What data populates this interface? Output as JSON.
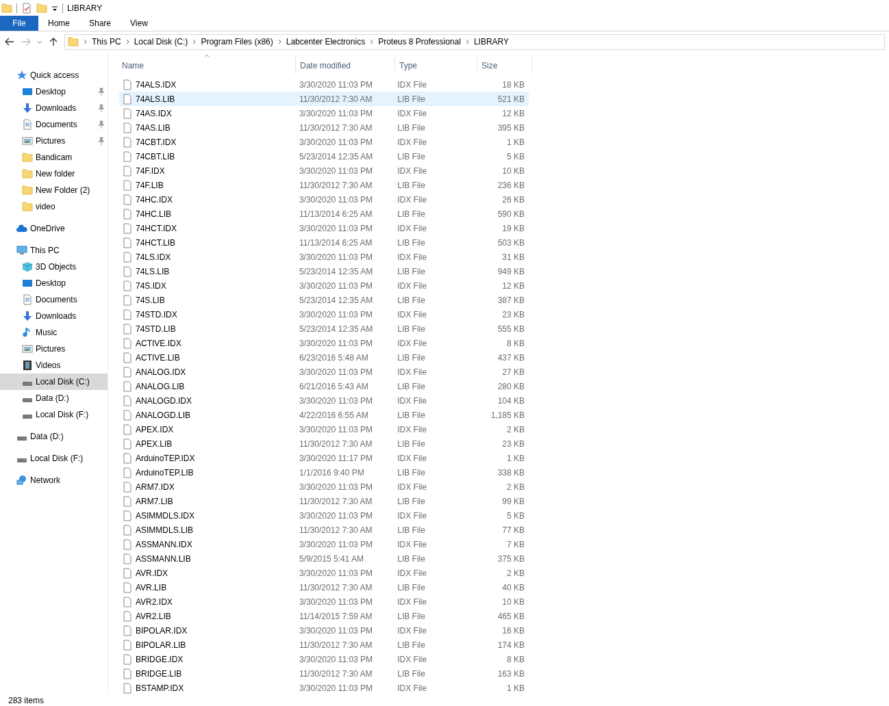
{
  "window": {
    "title": "LIBRARY"
  },
  "ribbon_tabs": [
    {
      "label": "File",
      "selected": true
    },
    {
      "label": "Home",
      "selected": false
    },
    {
      "label": "Share",
      "selected": false
    },
    {
      "label": "View",
      "selected": false
    }
  ],
  "breadcrumb": [
    "This PC",
    "Local Disk (C:)",
    "Program Files (x86)",
    "Labcenter Electronics",
    "Proteus 8 Professional",
    "LIBRARY"
  ],
  "sidebar": [
    {
      "label": "Quick access",
      "kind": "star",
      "selected": false,
      "children": [
        {
          "label": "Desktop",
          "kind": "desktop",
          "pinned": true,
          "selected": false
        },
        {
          "label": "Downloads",
          "kind": "downloads",
          "pinned": true,
          "selected": false
        },
        {
          "label": "Documents",
          "kind": "documents",
          "pinned": true,
          "selected": false
        },
        {
          "label": "Pictures",
          "kind": "pictures",
          "pinned": true,
          "selected": false
        },
        {
          "label": "Bandicam",
          "kind": "folder",
          "pinned": false,
          "selected": false
        },
        {
          "label": "New folder",
          "kind": "folder",
          "pinned": false,
          "selected": false
        },
        {
          "label": "New Folder (2)",
          "kind": "folder",
          "pinned": false,
          "selected": false
        },
        {
          "label": "video",
          "kind": "folder",
          "pinned": false,
          "selected": false
        }
      ]
    },
    {
      "label": "OneDrive",
      "kind": "cloud",
      "selected": false
    },
    {
      "label": "This PC",
      "kind": "pc",
      "selected": false,
      "children": [
        {
          "label": "3D Objects",
          "kind": "cube",
          "pinned": false,
          "selected": false
        },
        {
          "label": "Desktop",
          "kind": "desktop",
          "pinned": false,
          "selected": false
        },
        {
          "label": "Documents",
          "kind": "documents",
          "pinned": false,
          "selected": false
        },
        {
          "label": "Downloads",
          "kind": "downloads",
          "pinned": false,
          "selected": false
        },
        {
          "label": "Music",
          "kind": "music",
          "pinned": false,
          "selected": false
        },
        {
          "label": "Pictures",
          "kind": "pictures",
          "pinned": false,
          "selected": false
        },
        {
          "label": "Videos",
          "kind": "videos",
          "pinned": false,
          "selected": false
        },
        {
          "label": "Local Disk (C:)",
          "kind": "drive",
          "pinned": false,
          "selected": true
        },
        {
          "label": "Data (D:)",
          "kind": "drive",
          "pinned": false,
          "selected": false
        },
        {
          "label": "Local Disk (F:)",
          "kind": "drive",
          "pinned": false,
          "selected": false
        }
      ]
    },
    {
      "label": "Data (D:)",
      "kind": "drive",
      "selected": false
    },
    {
      "label": "Local Disk (F:)",
      "kind": "drive",
      "selected": false
    },
    {
      "label": "Network",
      "kind": "network",
      "selected": false
    }
  ],
  "table": {
    "columns": [
      "Name",
      "Date modified",
      "Type",
      "Size"
    ],
    "rows": [
      {
        "name": "74ALS.IDX",
        "date": "3/30/2020 11:03 PM",
        "type": "IDX File",
        "size": "18 KB",
        "highlighted": false
      },
      {
        "name": "74ALS.LIB",
        "date": "11/30/2012 7:30 AM",
        "type": "LIB File",
        "size": "521 KB",
        "highlighted": true
      },
      {
        "name": "74AS.IDX",
        "date": "3/30/2020 11:03 PM",
        "type": "IDX File",
        "size": "12 KB",
        "highlighted": false
      },
      {
        "name": "74AS.LIB",
        "date": "11/30/2012 7:30 AM",
        "type": "LIB File",
        "size": "395 KB",
        "highlighted": false
      },
      {
        "name": "74CBT.IDX",
        "date": "3/30/2020 11:03 PM",
        "type": "IDX File",
        "size": "1 KB",
        "highlighted": false
      },
      {
        "name": "74CBT.LIB",
        "date": "5/23/2014 12:35 AM",
        "type": "LIB File",
        "size": "5 KB",
        "highlighted": false
      },
      {
        "name": "74F.IDX",
        "date": "3/30/2020 11:03 PM",
        "type": "IDX File",
        "size": "10 KB",
        "highlighted": false
      },
      {
        "name": "74F.LIB",
        "date": "11/30/2012 7:30 AM",
        "type": "LIB File",
        "size": "236 KB",
        "highlighted": false
      },
      {
        "name": "74HC.IDX",
        "date": "3/30/2020 11:03 PM",
        "type": "IDX File",
        "size": "26 KB",
        "highlighted": false
      },
      {
        "name": "74HC.LIB",
        "date": "11/13/2014 6:25 AM",
        "type": "LIB File",
        "size": "590 KB",
        "highlighted": false
      },
      {
        "name": "74HCT.IDX",
        "date": "3/30/2020 11:03 PM",
        "type": "IDX File",
        "size": "19 KB",
        "highlighted": false
      },
      {
        "name": "74HCT.LIB",
        "date": "11/13/2014 6:25 AM",
        "type": "LIB File",
        "size": "503 KB",
        "highlighted": false
      },
      {
        "name": "74LS.IDX",
        "date": "3/30/2020 11:03 PM",
        "type": "IDX File",
        "size": "31 KB",
        "highlighted": false
      },
      {
        "name": "74LS.LIB",
        "date": "5/23/2014 12:35 AM",
        "type": "LIB File",
        "size": "949 KB",
        "highlighted": false
      },
      {
        "name": "74S.IDX",
        "date": "3/30/2020 11:03 PM",
        "type": "IDX File",
        "size": "12 KB",
        "highlighted": false
      },
      {
        "name": "74S.LIB",
        "date": "5/23/2014 12:35 AM",
        "type": "LIB File",
        "size": "387 KB",
        "highlighted": false
      },
      {
        "name": "74STD.IDX",
        "date": "3/30/2020 11:03 PM",
        "type": "IDX File",
        "size": "23 KB",
        "highlighted": false
      },
      {
        "name": "74STD.LIB",
        "date": "5/23/2014 12:35 AM",
        "type": "LIB File",
        "size": "555 KB",
        "highlighted": false
      },
      {
        "name": "ACTIVE.IDX",
        "date": "3/30/2020 11:03 PM",
        "type": "IDX File",
        "size": "8 KB",
        "highlighted": false
      },
      {
        "name": "ACTIVE.LIB",
        "date": "6/23/2016 5:48 AM",
        "type": "LIB File",
        "size": "437 KB",
        "highlighted": false
      },
      {
        "name": "ANALOG.IDX",
        "date": "3/30/2020 11:03 PM",
        "type": "IDX File",
        "size": "27 KB",
        "highlighted": false
      },
      {
        "name": "ANALOG.LIB",
        "date": "6/21/2016 5:43 AM",
        "type": "LIB File",
        "size": "280 KB",
        "highlighted": false
      },
      {
        "name": "ANALOGD.IDX",
        "date": "3/30/2020 11:03 PM",
        "type": "IDX File",
        "size": "104 KB",
        "highlighted": false
      },
      {
        "name": "ANALOGD.LIB",
        "date": "4/22/2016 6:55 AM",
        "type": "LIB File",
        "size": "1,185 KB",
        "highlighted": false
      },
      {
        "name": "APEX.IDX",
        "date": "3/30/2020 11:03 PM",
        "type": "IDX File",
        "size": "2 KB",
        "highlighted": false
      },
      {
        "name": "APEX.LIB",
        "date": "11/30/2012 7:30 AM",
        "type": "LIB File",
        "size": "23 KB",
        "highlighted": false
      },
      {
        "name": "ArduinoTEP.IDX",
        "date": "3/30/2020 11:17 PM",
        "type": "IDX File",
        "size": "1 KB",
        "highlighted": false
      },
      {
        "name": "ArduinoTEP.LIB",
        "date": "1/1/2016 9:40 PM",
        "type": "LIB File",
        "size": "338 KB",
        "highlighted": false
      },
      {
        "name": "ARM7.IDX",
        "date": "3/30/2020 11:03 PM",
        "type": "IDX File",
        "size": "2 KB",
        "highlighted": false
      },
      {
        "name": "ARM7.LIB",
        "date": "11/30/2012 7:30 AM",
        "type": "LIB File",
        "size": "99 KB",
        "highlighted": false
      },
      {
        "name": "ASIMMDLS.IDX",
        "date": "3/30/2020 11:03 PM",
        "type": "IDX File",
        "size": "5 KB",
        "highlighted": false
      },
      {
        "name": "ASIMMDLS.LIB",
        "date": "11/30/2012 7:30 AM",
        "type": "LIB File",
        "size": "77 KB",
        "highlighted": false
      },
      {
        "name": "ASSMANN.IDX",
        "date": "3/30/2020 11:03 PM",
        "type": "IDX File",
        "size": "7 KB",
        "highlighted": false
      },
      {
        "name": "ASSMANN.LIB",
        "date": "5/9/2015 5:41 AM",
        "type": "LIB File",
        "size": "375 KB",
        "highlighted": false
      },
      {
        "name": "AVR.IDX",
        "date": "3/30/2020 11:03 PM",
        "type": "IDX File",
        "size": "2 KB",
        "highlighted": false
      },
      {
        "name": "AVR.LIB",
        "date": "11/30/2012 7:30 AM",
        "type": "LIB File",
        "size": "40 KB",
        "highlighted": false
      },
      {
        "name": "AVR2.IDX",
        "date": "3/30/2020 11:03 PM",
        "type": "IDX File",
        "size": "10 KB",
        "highlighted": false
      },
      {
        "name": "AVR2.LIB",
        "date": "11/14/2015 7:59 AM",
        "type": "LIB File",
        "size": "465 KB",
        "highlighted": false
      },
      {
        "name": "BIPOLAR.IDX",
        "date": "3/30/2020 11:03 PM",
        "type": "IDX File",
        "size": "16 KB",
        "highlighted": false
      },
      {
        "name": "BIPOLAR.LIB",
        "date": "11/30/2012 7:30 AM",
        "type": "LIB File",
        "size": "174 KB",
        "highlighted": false
      },
      {
        "name": "BRIDGE.IDX",
        "date": "3/30/2020 11:03 PM",
        "type": "IDX File",
        "size": "8 KB",
        "highlighted": false
      },
      {
        "name": "BRIDGE.LIB",
        "date": "11/30/2012 7:30 AM",
        "type": "LIB File",
        "size": "163 KB",
        "highlighted": false
      },
      {
        "name": "BSTAMP.IDX",
        "date": "3/30/2020 11:03 PM",
        "type": "IDX File",
        "size": "1 KB",
        "highlighted": false
      }
    ]
  },
  "status_bar": {
    "item_count": "283 items"
  }
}
